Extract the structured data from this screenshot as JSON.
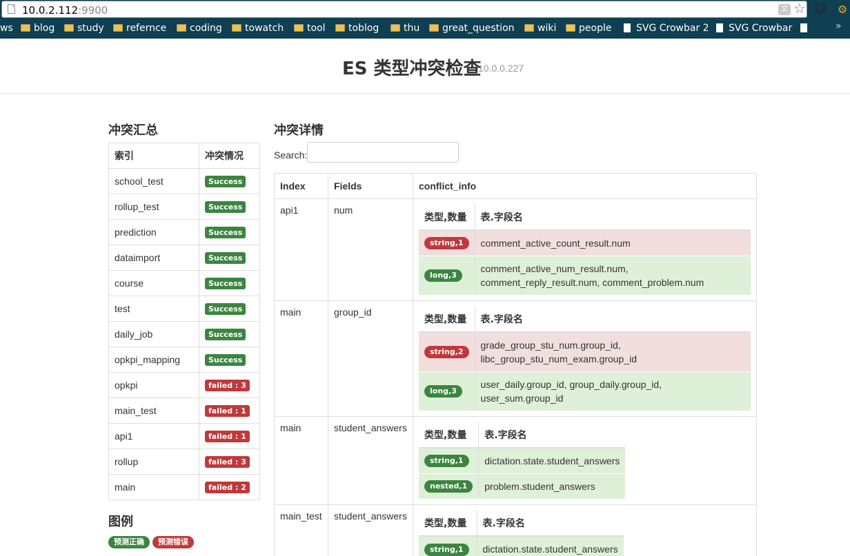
{
  "browser": {
    "url_host": "10.0.2.112",
    "url_port": ":9900",
    "bookmarks": [
      "ws",
      "blog",
      "study",
      "refernce",
      "coding",
      "towatch",
      "tool",
      "toblog",
      "thu",
      "great_question",
      "wiki",
      "people",
      "SVG Crowbar 2",
      "SVG Crowbar"
    ],
    "more": "»"
  },
  "header": {
    "title": "ES 类型冲突检查",
    "ip": "10.0.0.227"
  },
  "summary": {
    "title": "冲突汇总",
    "col_index": "索引",
    "col_status": "冲突情况",
    "rows": [
      {
        "index": "school_test",
        "status": "Success",
        "ok": true
      },
      {
        "index": "rollup_test",
        "status": "Success",
        "ok": true
      },
      {
        "index": "prediction",
        "status": "Success",
        "ok": true
      },
      {
        "index": "dataimport",
        "status": "Success",
        "ok": true
      },
      {
        "index": "course",
        "status": "Success",
        "ok": true
      },
      {
        "index": "test",
        "status": "Success",
        "ok": true
      },
      {
        "index": "daily_job",
        "status": "Success",
        "ok": true
      },
      {
        "index": "opkpi_mapping",
        "status": "Success",
        "ok": true
      },
      {
        "index": "opkpi",
        "status": "failed : 3",
        "ok": false
      },
      {
        "index": "main_test",
        "status": "failed : 1",
        "ok": false
      },
      {
        "index": "api1",
        "status": "failed : 1",
        "ok": false
      },
      {
        "index": "rollup",
        "status": "failed : 3",
        "ok": false
      },
      {
        "index": "main",
        "status": "failed : 2",
        "ok": false
      }
    ]
  },
  "legend": {
    "title": "图例",
    "correct": "预测正确",
    "wrong": "预测错误"
  },
  "detail": {
    "title": "冲突详情",
    "search_label": "Search:",
    "search_value": "",
    "col_index": "Index",
    "col_fields": "Fields",
    "col_info": "conflict_info",
    "inner_col_type": "类型,数量",
    "inner_col_fields": "表.字段名",
    "rows": [
      {
        "index": "api1",
        "field": "num",
        "conflicts": [
          {
            "badge": "string,1",
            "ok": false,
            "lines": [
              "comment_active_count_result.num"
            ]
          },
          {
            "badge": "long,3",
            "ok": true,
            "lines": [
              "comment_active_num_result.num,",
              "comment_reply_result.num, comment_problem.num"
            ]
          }
        ]
      },
      {
        "index": "main",
        "field": "group_id",
        "conflicts": [
          {
            "badge": "string,2",
            "ok": false,
            "lines": [
              "grade_group_stu_num.group_id,",
              "libc_group_stu_num_exam.group_id"
            ]
          },
          {
            "badge": "long,3",
            "ok": true,
            "lines": [
              "user_daily.group_id, group_daily.group_id,",
              "user_sum.group_id"
            ]
          }
        ]
      },
      {
        "index": "main",
        "field": "student_answers",
        "conflicts": [
          {
            "badge": "string,1",
            "ok": true,
            "lines": [
              "dictation.state.student_answers"
            ]
          },
          {
            "badge": "nested,1",
            "ok": true,
            "lines": [
              "problem.student_answers"
            ]
          }
        ]
      },
      {
        "index": "main_test",
        "field": "student_answers",
        "conflicts": [
          {
            "badge": "string,1",
            "ok": true,
            "lines": [
              "dictation.state.student_answers"
            ]
          }
        ]
      }
    ]
  }
}
